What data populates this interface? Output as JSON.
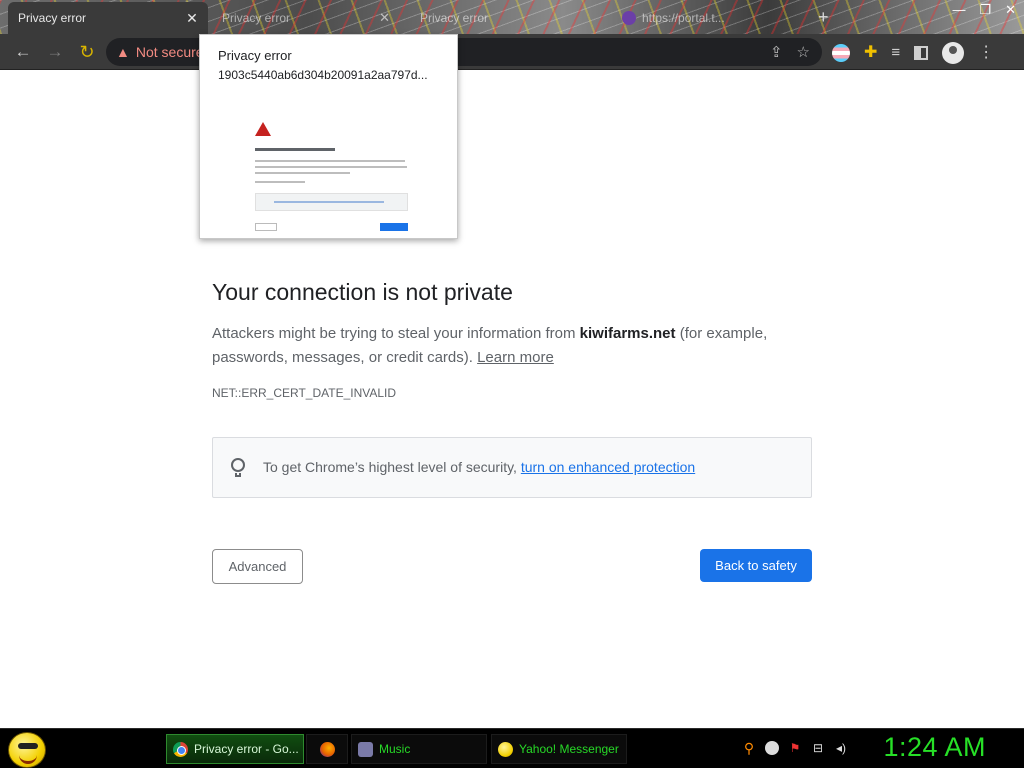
{
  "browser": {
    "tabs": [
      {
        "title": "Privacy error",
        "active": true
      },
      {
        "title": "Privacy error",
        "active": false
      },
      {
        "title": "Privacy error",
        "active": false
      },
      {
        "title": "https://portal.t...",
        "active": false
      }
    ],
    "omnibox": {
      "security_label": "Not secure"
    }
  },
  "hover_card": {
    "title": "Privacy error",
    "url": "1903c5440ab6d304b20091a2aa797d..."
  },
  "interstitial": {
    "heading": "Your connection is not private",
    "desc_prefix": "Attackers might be trying to steal your information from ",
    "domain": "kiwifarms.net",
    "desc_suffix": " (for example, passwords, messages, or credit cards). ",
    "learn_more": "Learn more",
    "error_code": "NET::ERR_CERT_DATE_INVALID",
    "enhanced_text": "To get Chrome’s highest level of security, ",
    "enhanced_link": "turn on enhanced protection",
    "advanced_button": "Advanced",
    "back_button": "Back to safety"
  },
  "taskbar": {
    "tasks": [
      {
        "label": "Privacy error - Go..."
      },
      {
        "label": ""
      },
      {
        "label": "Music"
      },
      {
        "label": "Yahoo! Messenger"
      }
    ],
    "clock": "1:24 AM"
  },
  "colors": {
    "accent": "#1a73e8",
    "warning": "#f28b82",
    "taskbar_text": "#27d827",
    "clock": "#27e027"
  },
  "icons": [
    "back-icon",
    "forward-icon",
    "reload-icon",
    "warning-icon",
    "share-icon",
    "star-icon",
    "profile-icon",
    "puzzle-icon",
    "lightbulb-icon",
    "chrome-icon",
    "firefox-icon",
    "music-icon",
    "yahoo-icon",
    "search-icon",
    "volume-icon",
    "network-icon",
    "flag-icon"
  ]
}
